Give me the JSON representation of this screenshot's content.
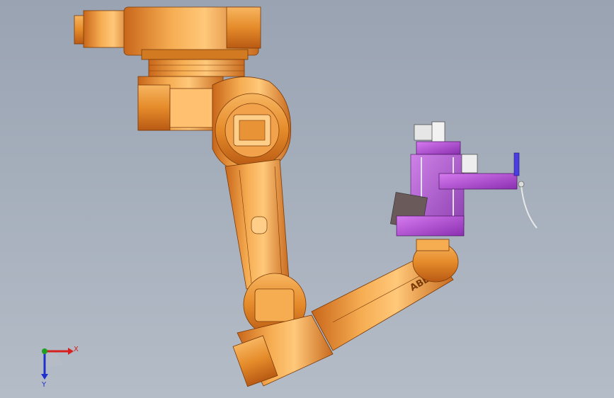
{
  "viewport": {
    "background_top": "#9aa3b2",
    "background_bottom": "#b4bcc7"
  },
  "model": {
    "robot_color": "#e8922a",
    "tool_color": "#b24ad6",
    "arm_brand": "ABB"
  },
  "triad": {
    "x_label": "X",
    "y_label": "Y",
    "x_color": "#d62020",
    "y_color": "#2030d0",
    "z_color": "#20a020"
  }
}
